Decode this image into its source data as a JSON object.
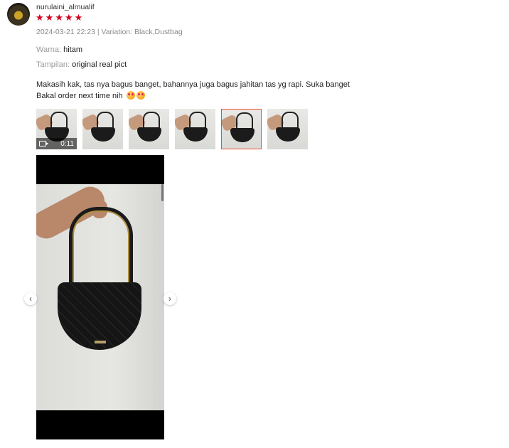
{
  "review": {
    "username": "nurulaini_almualif",
    "rating": 5,
    "meta": "2024-03-21 22:23 | Variation: Black,Dustbag",
    "attributes": [
      {
        "key": "Warna:",
        "value": "hitam"
      },
      {
        "key": "Tampilan:",
        "value": "original real pict"
      }
    ],
    "comment_line1": "Makasih kak, tas nya bagus banget, bahannya juga bagus jahitan tas yg rapi. Suka banget",
    "comment_line2": "Bakal order next time nih"
  },
  "media": {
    "video_duration": "0:11",
    "thumbnail_count": 6,
    "active_index": 4
  },
  "icons": {
    "star": "star-icon",
    "video": "video-camera-icon",
    "prev": "chevron-left-icon",
    "next": "chevron-right-icon"
  },
  "colors": {
    "star": "#d0011b",
    "active_border": "#ee4d2d"
  }
}
